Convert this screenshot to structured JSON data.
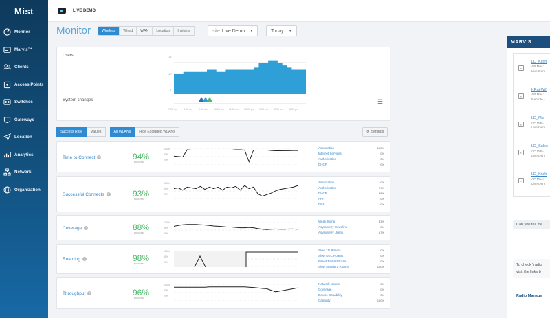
{
  "sidebar": {
    "logo": "Mist",
    "items": [
      {
        "label": "Monitor",
        "icon": "monitor-icon"
      },
      {
        "label": "Marvis™",
        "icon": "marvis-icon"
      },
      {
        "label": "Clients",
        "icon": "clients-icon"
      },
      {
        "label": "Access Points",
        "icon": "access-point-icon"
      },
      {
        "label": "Switches",
        "icon": "switch-icon"
      },
      {
        "label": "Gateways",
        "icon": "gateway-icon"
      },
      {
        "label": "Location",
        "icon": "location-icon"
      },
      {
        "label": "Analytics",
        "icon": "analytics-icon"
      },
      {
        "label": "Network",
        "icon": "network-icon"
      },
      {
        "label": "Organization",
        "icon": "organization-icon"
      }
    ]
  },
  "topbar": {
    "org": "LIVE DEMO"
  },
  "page": {
    "title": "Monitor",
    "tabs": [
      "Wireless",
      "Wired",
      "WAN",
      "Location",
      "Insights"
    ],
    "active_tab": "Wireless",
    "site_label": "site",
    "site_value": "Live Demo",
    "range_value": "Today"
  },
  "users_card": {
    "users_label": "Users",
    "system_changes_label": "System changes",
    "y_ticks": [
      "15",
      "10",
      "5"
    ],
    "x_ticks": [
      "7:00 am",
      "8:00 am",
      "9:00 am",
      "10:00 am",
      "11:00 am",
      "12:00 pm",
      "1:00 pm",
      "2:00 pm",
      "3:00 pm"
    ],
    "users_series": [
      9,
      9,
      10,
      10,
      10,
      10,
      10,
      11,
      11,
      10,
      10,
      11,
      11,
      11,
      11,
      11,
      11,
      12,
      14,
      14,
      15,
      15,
      14,
      13,
      12,
      11,
      11,
      11
    ],
    "accent_color": "#2f9fd8"
  },
  "controls": {
    "success_rate": "Success Rate",
    "values": "Values",
    "all_wlans": "All WLANs",
    "hide_excluded": "Hide Excluded WLANs",
    "settings": "Settings"
  },
  "metrics": [
    {
      "label": "Time to Connect",
      "pct": "94%",
      "sub": "success",
      "ticks": [
        "100%",
        "50%",
        "20%"
      ],
      "spark": [
        58,
        55,
        52,
        100,
        98,
        98,
        98,
        98,
        98,
        98,
        98,
        98,
        98,
        98,
        100,
        100,
        98,
        20,
        98,
        98,
        98,
        98,
        95,
        93,
        93,
        94,
        94,
        95,
        95
      ],
      "classifiers": [
        {
          "name": "Association",
          "value": "100%"
        },
        {
          "name": "Internet Services",
          "value": "0%"
        },
        {
          "name": "Authorization",
          "value": "0%"
        },
        {
          "name": "DHCP",
          "value": "0%"
        }
      ]
    },
    {
      "label": "Successful Connects",
      "pct": "93%",
      "sub": "success",
      "ticks": [
        "100%",
        "50%",
        "20%"
      ],
      "spark": [
        70,
        75,
        60,
        80,
        75,
        70,
        85,
        65,
        80,
        70,
        80,
        60,
        80,
        75,
        85,
        60,
        90,
        70,
        80,
        35,
        20,
        30,
        40,
        55,
        65,
        70,
        75,
        80,
        90
      ],
      "classifiers": [
        {
          "name": "Association",
          "value": "0%"
        },
        {
          "name": "Authorization",
          "value": "27%"
        },
        {
          "name": "DHCP",
          "value": "38%"
        },
        {
          "name": "ARP",
          "value": "0%"
        },
        {
          "name": "DNS",
          "value": "0%"
        }
      ]
    },
    {
      "label": "Coverage",
      "pct": "88%",
      "sub": "success",
      "ticks": [
        "100%",
        "50%",
        "20%"
      ],
      "spark": [
        80,
        85,
        90,
        92,
        92,
        92,
        90,
        88,
        85,
        82,
        80,
        78,
        75,
        75,
        72,
        70,
        70,
        72,
        70,
        65,
        60,
        58,
        60,
        62,
        60,
        60,
        62,
        62,
        60
      ],
      "classifiers": [
        {
          "name": "Weak Signal",
          "value": "83%"
        },
        {
          "name": "Asymmetry Downlink",
          "value": "0%"
        },
        {
          "name": "Asymmetry Uplink",
          "value": "17%"
        }
      ]
    },
    {
      "label": "Roaming",
      "pct": "98%",
      "sub": "success",
      "ticks": [
        "100%",
        "50%",
        "20%"
      ],
      "spark": [
        null,
        null,
        null,
        null,
        null,
        null,
        null,
        null,
        25,
        null,
        null,
        null,
        null,
        null,
        null,
        null,
        null,
        null,
        null,
        null,
        null,
        null,
        null,
        null,
        null,
        null,
        null,
        null,
        null
      ],
      "classifiers": [
        {
          "name": "Slow 11r Roams",
          "value": "0%"
        },
        {
          "name": "Slow OKC Roams",
          "value": "0%"
        },
        {
          "name": "Failed To Fast Roam",
          "value": "0%"
        },
        {
          "name": "Slow Standard Roams",
          "value": "100%"
        }
      ]
    },
    {
      "label": "Throughput",
      "pct": "96%",
      "sub": "success",
      "ticks": [
        "100%",
        "50%",
        "20%"
      ],
      "spark": [
        90,
        90,
        90,
        90,
        90,
        90,
        90,
        90,
        92,
        92,
        92,
        92,
        92,
        92,
        92,
        92,
        92,
        90,
        88,
        85,
        82,
        80,
        70,
        60,
        65,
        70,
        75,
        80,
        85
      ],
      "classifiers": [
        {
          "name": "Network Issues",
          "value": "0%"
        },
        {
          "name": "Coverage",
          "value": "0%"
        },
        {
          "name": "Device Capability",
          "value": "0%"
        },
        {
          "name": "Capacity",
          "value": "100%"
        }
      ]
    }
  ],
  "marvis": {
    "title": "MARVIS",
    "items": [
      {
        "name": "LD_Kitch",
        "l1": "AP Mac: ",
        "l2": "Live Dem",
        "l3": ""
      },
      {
        "name": "KRaj-Wifi",
        "l1": "AP Mac: ",
        "l2": "Remote -",
        "l3": ""
      },
      {
        "name": "LD_Mar",
        "l1": "AP Mac: ",
        "l2": "Live Dem",
        "l3": ""
      },
      {
        "name": "LD_Sales",
        "l1": "AP Mac: ",
        "l2": "Live Dem",
        "l3": ""
      },
      {
        "name": "LD_Kitch",
        "l1": "AP Mac: ",
        "l2": "Live Dem",
        "l3": ""
      }
    ],
    "question": "Can you tell me",
    "answer_l1": "To check \"radio",
    "answer_l2": "visit the links b",
    "link": "Radio Manage"
  }
}
